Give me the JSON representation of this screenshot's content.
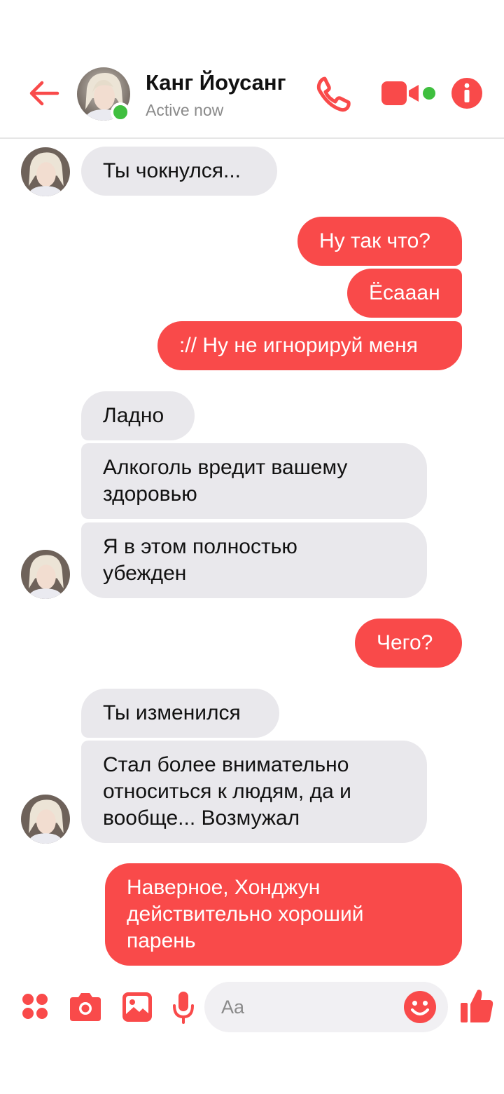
{
  "header": {
    "contact_name": "Канг Йоусанг",
    "status": "Active now"
  },
  "messages": [
    {
      "side": "in",
      "text": "Ты чокнулся..."
    },
    {
      "side": "out",
      "text": "Ну так что?"
    },
    {
      "side": "out",
      "text": "Ёсааан"
    },
    {
      "side": "out",
      "text": ":// Ну не игнорируй меня"
    },
    {
      "side": "in",
      "text": "Ладно"
    },
    {
      "side": "in",
      "lines": [
        "Алкоголь вредит вашему",
        "здоровью"
      ]
    },
    {
      "side": "in",
      "lines": [
        "Я в этом полностью",
        "убежден"
      ]
    },
    {
      "side": "out",
      "text": "Чего?"
    },
    {
      "side": "in",
      "text": "Ты изменился"
    },
    {
      "side": "in",
      "lines": [
        "Стал более внимательно",
        "относиться к людям, да и",
        "вообще... Возмужал"
      ]
    },
    {
      "side": "out",
      "lines": [
        "Наверное, Хонджун",
        "действительно хороший",
        "парень"
      ]
    }
  ],
  "composer": {
    "placeholder": "Aa"
  },
  "colors": {
    "accent": "#f94a4a",
    "incoming_bubble": "#e9e8ec",
    "online": "#3fbf3f"
  },
  "icons": [
    "back-arrow-icon",
    "phone-icon",
    "video-camera-icon",
    "info-icon",
    "apps-grid-icon",
    "camera-icon",
    "image-icon",
    "microphone-icon",
    "emoji-icon",
    "thumbs-up-icon"
  ]
}
